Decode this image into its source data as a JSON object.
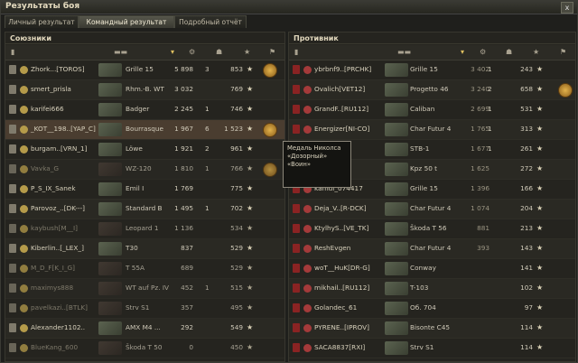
{
  "window": {
    "title": "Результаты боя",
    "close": "x"
  },
  "tabs": [
    {
      "label": "Личный результат"
    },
    {
      "label": "Командный результат",
      "active": true
    },
    {
      "label": "Подробный отчёт"
    }
  ],
  "allies": {
    "title": "Союзники",
    "rows": [
      {
        "player": "Zhork...[TOROS]",
        "tank": "Grille 15",
        "dmg": "5 898",
        "kills": "3",
        "xp": "853",
        "medal": true,
        "alive": true
      },
      {
        "player": "smert_prisla",
        "tank": "Rhm.-B. WT",
        "dmg": "3 032",
        "kills": "",
        "xp": "769",
        "medal": false,
        "alive": true
      },
      {
        "player": "karifei666",
        "tank": "Badger",
        "dmg": "2 245",
        "kills": "1",
        "xp": "746",
        "medal": false,
        "alive": true
      },
      {
        "player": "_KOT__198..[YAP_C]",
        "tank": "Bourrasque",
        "dmg": "1 967",
        "kills": "6",
        "xp": "1 523",
        "medal": true,
        "alive": true,
        "highlight": true
      },
      {
        "player": "burgam..[VRN_1]",
        "tank": "Löwe",
        "dmg": "1 921",
        "kills": "2",
        "xp": "961",
        "medal": false,
        "alive": true
      },
      {
        "player": "Vavka_G",
        "tank": "WZ-120",
        "dmg": "1 810",
        "kills": "1",
        "xp": "766",
        "medal": true,
        "alive": false
      },
      {
        "player": "P_S_IX_Sanek",
        "tank": "Emil I",
        "dmg": "1 769",
        "kills": "",
        "xp": "775",
        "medal": false,
        "alive": true
      },
      {
        "player": "Parovoz_..[DK---]",
        "tank": "Standard B",
        "dmg": "1 495",
        "kills": "1",
        "xp": "702",
        "medal": false,
        "alive": true
      },
      {
        "player": "kaybush[M__I]",
        "tank": "Leopard 1",
        "dmg": "1 136",
        "kills": "",
        "xp": "534",
        "medal": false,
        "alive": false
      },
      {
        "player": "Kiberlin..[_LEX_]",
        "tank": "T30",
        "dmg": "837",
        "kills": "",
        "xp": "529",
        "medal": false,
        "alive": true
      },
      {
        "player": "M_D_F[K_I_G]",
        "tank": "T 55A",
        "dmg": "689",
        "kills": "",
        "xp": "529",
        "medal": false,
        "alive": false
      },
      {
        "player": "maximys888",
        "tank": "WT auf Pz. IV",
        "dmg": "452",
        "kills": "1",
        "xp": "515",
        "medal": false,
        "alive": false
      },
      {
        "player": "pavelkazi..[BTLK]",
        "tank": "Strv S1",
        "dmg": "357",
        "kills": "",
        "xp": "495",
        "medal": false,
        "alive": false
      },
      {
        "player": "Alexander1102..",
        "tank": "AMX M4 ...",
        "dmg": "292",
        "kills": "",
        "xp": "549",
        "medal": false,
        "alive": true
      },
      {
        "player": "BlueKang_600",
        "tank": "Škoda T 50",
        "dmg": "0",
        "kills": "",
        "xp": "450",
        "medal": false,
        "alive": false
      }
    ]
  },
  "enemies": {
    "title": "Противник",
    "rows": [
      {
        "player": "ybrbnf9..[PRCHK]",
        "tank": "Grille 15",
        "dmg": "3 402",
        "kills": "1",
        "xp": "243",
        "medal": false
      },
      {
        "player": "Ovalich[VET12]",
        "tank": "Progetto 46",
        "dmg": "3 240",
        "kills": "2",
        "xp": "658",
        "medal": true
      },
      {
        "player": "GrandF..[RU112]",
        "tank": "Caliban",
        "dmg": "2 699",
        "kills": "1",
        "xp": "531",
        "medal": false
      },
      {
        "player": "Energizer[NI-CO]",
        "tank": "Char Futur 4",
        "dmg": "1 765",
        "kills": "1",
        "xp": "313",
        "medal": false
      },
      {
        "player": "",
        "tank": "STB-1",
        "dmg": "1 677",
        "kills": "1",
        "xp": "261",
        "medal": false
      },
      {
        "player": "",
        "tank": "Kpz 50 t",
        "dmg": "1 625",
        "kills": "",
        "xp": "272",
        "medal": false
      },
      {
        "player": "kamui_074417",
        "tank": "Grille 15",
        "dmg": "1 396",
        "kills": "",
        "xp": "166",
        "medal": false
      },
      {
        "player": "Deja_V..[R-DCK]",
        "tank": "Char Futur 4",
        "dmg": "1 074",
        "kills": "",
        "xp": "204",
        "medal": false
      },
      {
        "player": "KtylhyS..[VE_TK]",
        "tank": "Škoda T 56",
        "dmg": "881",
        "kills": "",
        "xp": "213",
        "medal": false
      },
      {
        "player": "ReshEvgen",
        "tank": "Char Futur 4",
        "dmg": "393",
        "kills": "",
        "xp": "143",
        "medal": false
      },
      {
        "player": "woT__HuK[DR-G]",
        "tank": "Conway",
        "dmg": "",
        "kills": "",
        "xp": "141",
        "medal": false
      },
      {
        "player": "mikhail..[RU112]",
        "tank": "T-103",
        "dmg": "",
        "kills": "",
        "xp": "102",
        "medal": false
      },
      {
        "player": "Golandec_61",
        "tank": "Об. 704",
        "dmg": "",
        "kills": "",
        "xp": "97",
        "medal": false
      },
      {
        "player": "PYRENE..[IPROV]",
        "tank": "Bisonte C45",
        "dmg": "",
        "kills": "",
        "xp": "114",
        "medal": false
      },
      {
        "player": "SACA8837[RXI]",
        "tank": "Strv S1",
        "dmg": "",
        "kills": "",
        "xp": "114",
        "medal": false
      }
    ]
  },
  "tooltip": {
    "lines": [
      "Медаль Николса",
      "«Дозорный»",
      "«Воин»"
    ]
  }
}
